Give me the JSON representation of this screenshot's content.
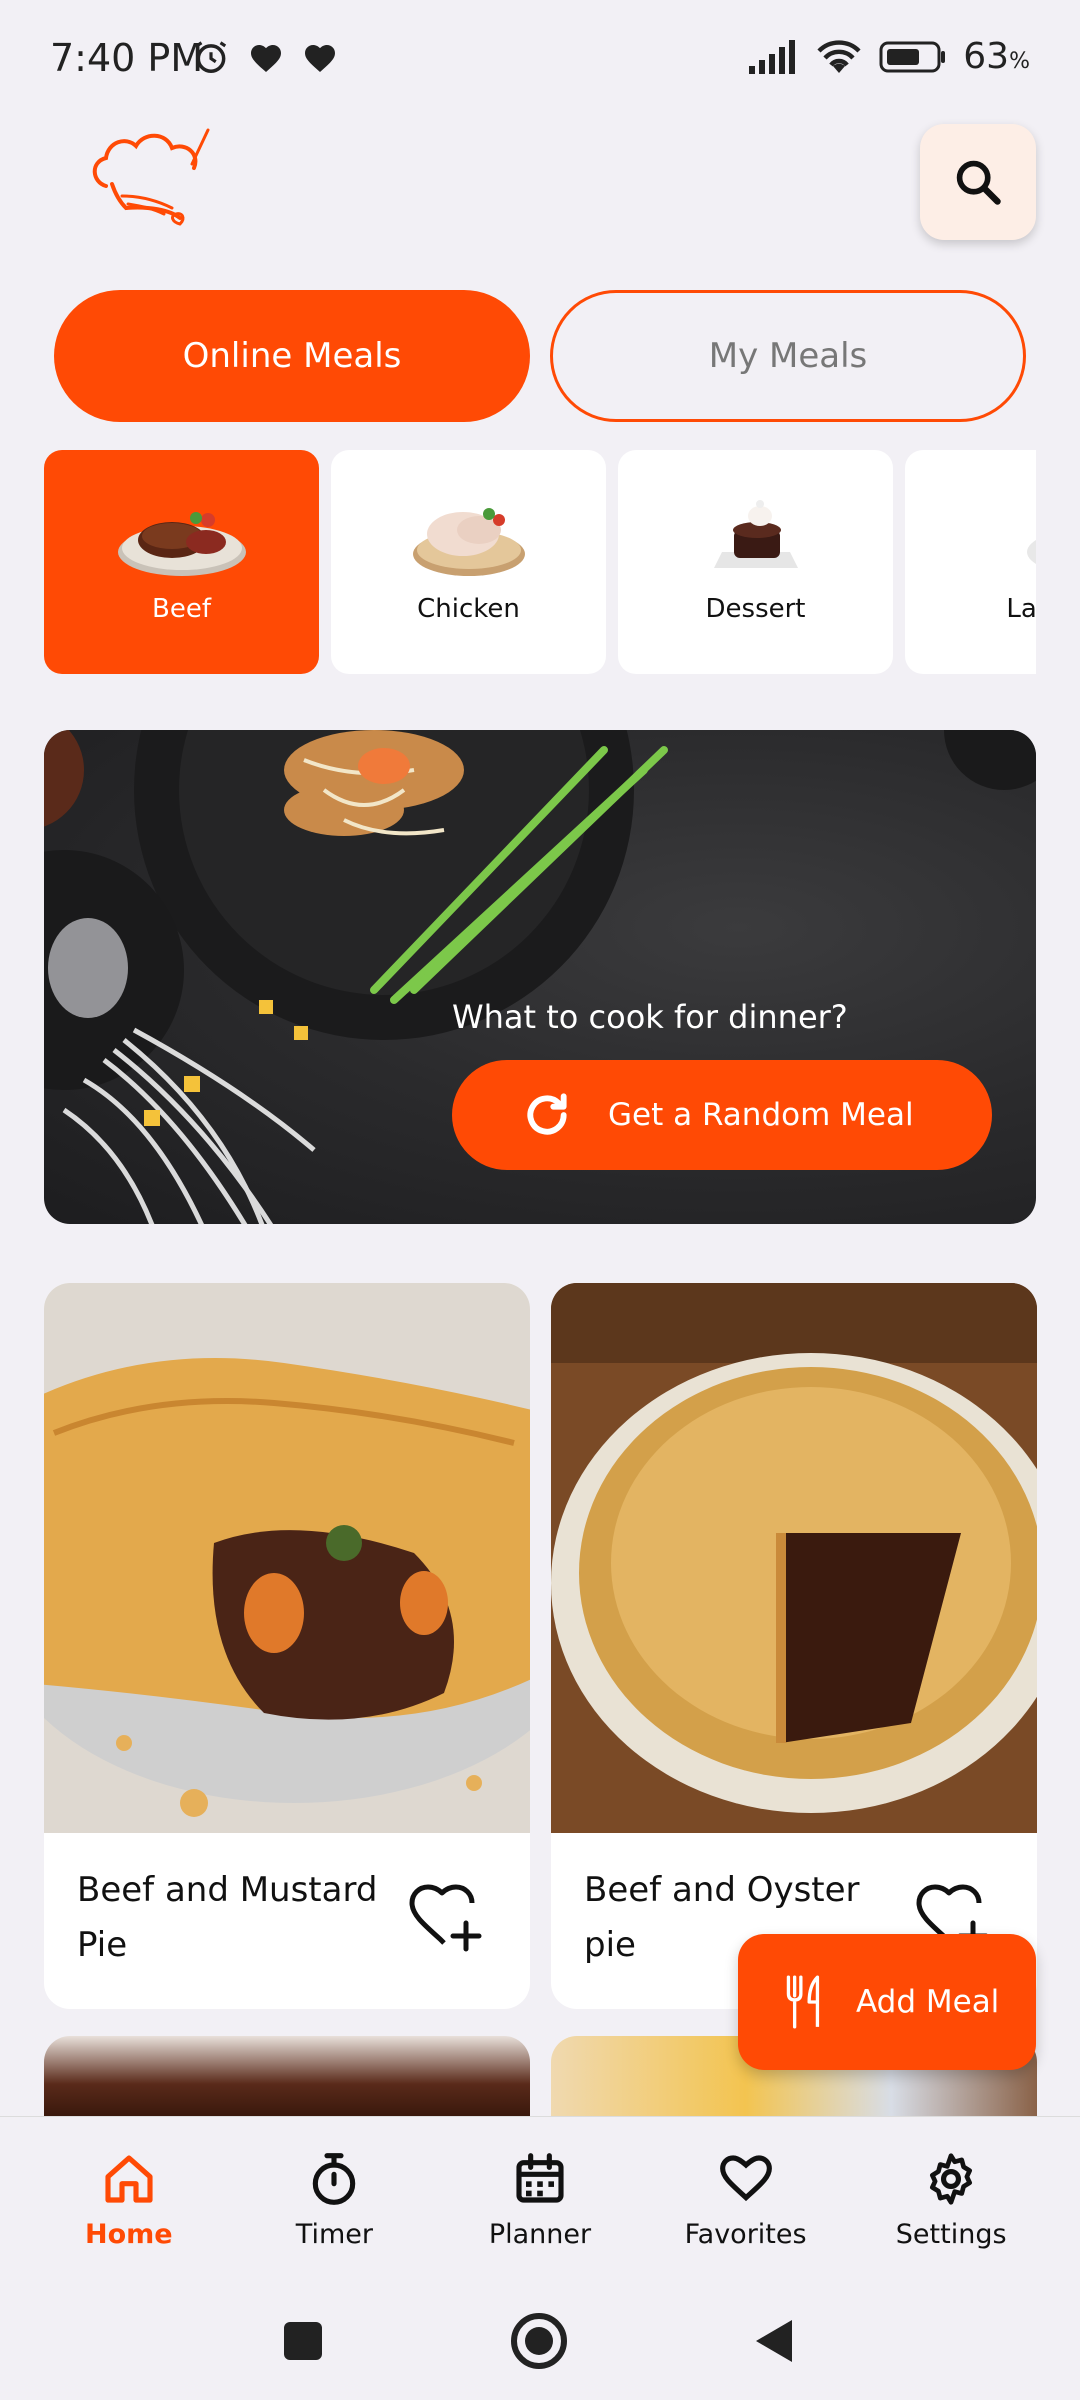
{
  "status_bar": {
    "time": "7:40 PM",
    "battery_percent": "63",
    "battery_unit": "%"
  },
  "header": {
    "logo_icon": "chef-hat-logo",
    "search_icon": "search-icon"
  },
  "tabs": {
    "online_label": "Online Meals",
    "my_label": "My Meals",
    "active": "Online Meals"
  },
  "categories": [
    {
      "label": "Beef",
      "active": true
    },
    {
      "label": "Chicken",
      "active": false
    },
    {
      "label": "Dessert",
      "active": false
    },
    {
      "label": "Lamb",
      "active": false
    }
  ],
  "hero": {
    "question": "What to cook for dinner?",
    "button_label": "Get a Random Meal"
  },
  "meals": [
    {
      "title": "Beef and Mustard Pie"
    },
    {
      "title": "Beef and Oyster pie"
    }
  ],
  "fab": {
    "label": "Add Meal"
  },
  "bottom_nav": [
    {
      "label": "Home",
      "icon": "home-icon",
      "active": true
    },
    {
      "label": "Timer",
      "icon": "timer-icon",
      "active": false
    },
    {
      "label": "Planner",
      "icon": "calendar-icon",
      "active": false
    },
    {
      "label": "Favorites",
      "icon": "heart-icon",
      "active": false
    },
    {
      "label": "Settings",
      "icon": "gear-icon",
      "active": false
    }
  ],
  "colors": {
    "accent": "#ff4a05",
    "background": "#f2f0f5"
  }
}
